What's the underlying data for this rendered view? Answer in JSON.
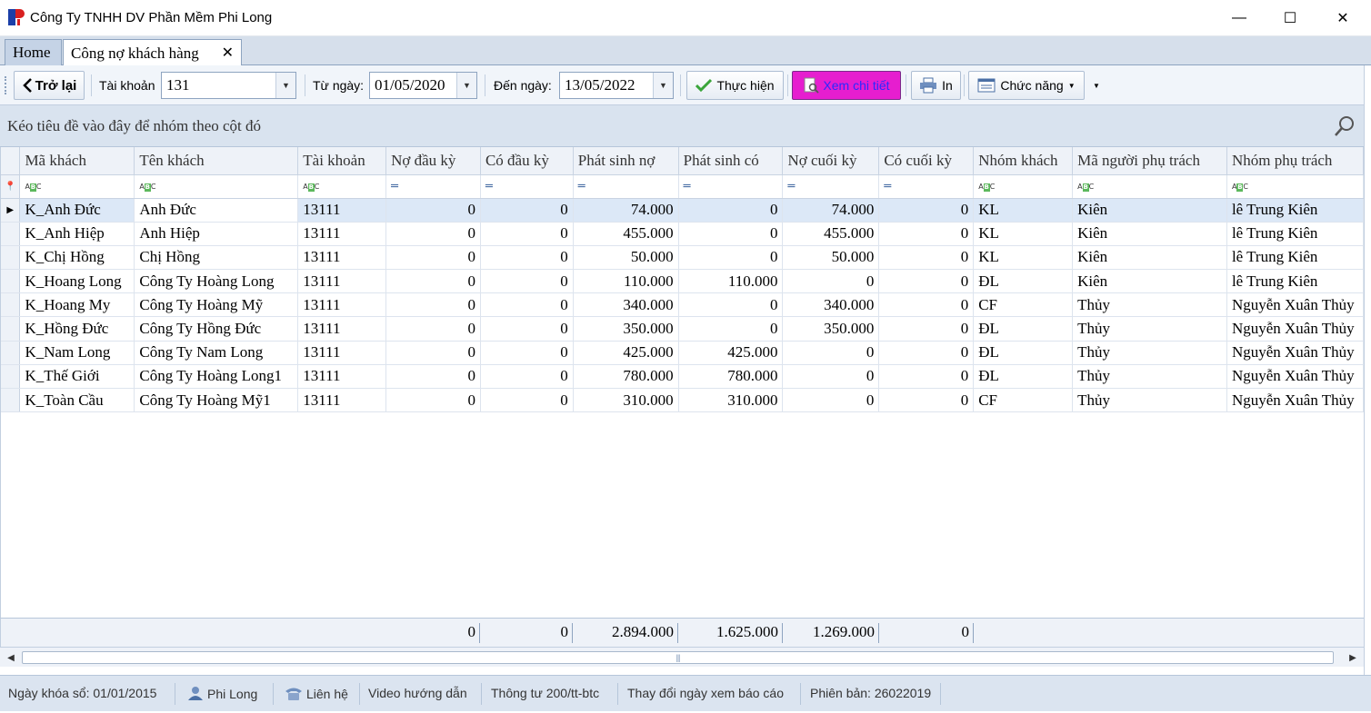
{
  "window": {
    "title": "Công Ty TNHH DV Phần Mềm Phi Long",
    "minimize": "—",
    "maximize": "☐",
    "close": "✕"
  },
  "tabs": [
    {
      "label": "Home"
    },
    {
      "label": "Công nợ khách hàng",
      "close": "✕"
    }
  ],
  "toolbar": {
    "back_label": "Trở lại",
    "account_label": "Tài khoản",
    "account_value": "131",
    "from_label": "Từ ngày:",
    "from_value": "01/05/2020",
    "to_label": "Đến ngày:",
    "to_value": "13/05/2022",
    "execute_label": "Thực hiện",
    "detail_label": "Xem chi tiết",
    "print_label": "In",
    "functions_label": "Chức năng"
  },
  "group_panel": {
    "text": "Kéo tiêu đề vào đây để nhóm theo cột đó"
  },
  "grid": {
    "columns": [
      "Mã khách",
      "Tên khách",
      "Tài khoản",
      "Nợ đầu kỳ",
      "Có đầu kỳ",
      "Phát sinh nợ",
      "Phát sinh có",
      "Nợ cuối kỳ",
      "Có cuối kỳ",
      "Nhóm khách",
      "Mã người phụ trách",
      "Nhóm phụ trách"
    ],
    "rows": [
      [
        "K_Anh Đức",
        "Anh Đức",
        "13111",
        "0",
        "0",
        "74.000",
        "0",
        "74.000",
        "0",
        "KL",
        "Kiên",
        "lê Trung Kiên"
      ],
      [
        "K_Anh Hiệp",
        "Anh Hiệp",
        "13111",
        "0",
        "0",
        "455.000",
        "0",
        "455.000",
        "0",
        "KL",
        "Kiên",
        "lê Trung Kiên"
      ],
      [
        "K_Chị Hồng",
        "Chị Hồng",
        "13111",
        "0",
        "0",
        "50.000",
        "0",
        "50.000",
        "0",
        "KL",
        "Kiên",
        "lê Trung Kiên"
      ],
      [
        "K_Hoang Long",
        "Công Ty Hoàng Long",
        "13111",
        "0",
        "0",
        "110.000",
        "110.000",
        "0",
        "0",
        "ĐL",
        "Kiên",
        "lê Trung Kiên"
      ],
      [
        "K_Hoang My",
        "Công Ty Hoàng Mỹ",
        "13111",
        "0",
        "0",
        "340.000",
        "0",
        "340.000",
        "0",
        "CF",
        "Thủy",
        "Nguyễn Xuân Thủy"
      ],
      [
        "K_Hồng Đức",
        "Công Ty Hồng Đức",
        "13111",
        "0",
        "0",
        "350.000",
        "0",
        "350.000",
        "0",
        "ĐL",
        "Thủy",
        "Nguyễn Xuân Thủy"
      ],
      [
        "K_Nam Long",
        "Công Ty Nam Long",
        "13111",
        "0",
        "0",
        "425.000",
        "425.000",
        "0",
        "0",
        "ĐL",
        "Thủy",
        "Nguyễn Xuân Thủy"
      ],
      [
        "K_Thế Giới",
        "Công Ty Hoàng Long1",
        "13111",
        "0",
        "0",
        "780.000",
        "780.000",
        "0",
        "0",
        "ĐL",
        "Thủy",
        "Nguyễn Xuân Thủy"
      ],
      [
        "K_Toàn Cầu",
        "Công Ty Hoàng Mỹ1",
        "13111",
        "0",
        "0",
        "310.000",
        "310.000",
        "0",
        "0",
        "CF",
        "Thủy",
        "Nguyễn Xuân Thủy"
      ]
    ],
    "totals": [
      "0",
      "0",
      "2.894.000",
      "1.625.000",
      "1.269.000",
      "0"
    ]
  },
  "statusbar": {
    "lock_date": "Ngày khóa sổ: 01/01/2015",
    "user": "Phi Long",
    "contact": "Liên hệ",
    "video": "Video hướng dẫn",
    "circular": "Thông tư 200/tt-btc",
    "change_date": "Thay đổi ngày xem báo cáo",
    "version": "Phiên bản: 26022019"
  },
  "colors": {
    "detail_button_bg": "#e61ecf",
    "detail_button_text": "#2a2aff",
    "selected_row": "#dce8f7",
    "check_green": "#3aa53a"
  }
}
